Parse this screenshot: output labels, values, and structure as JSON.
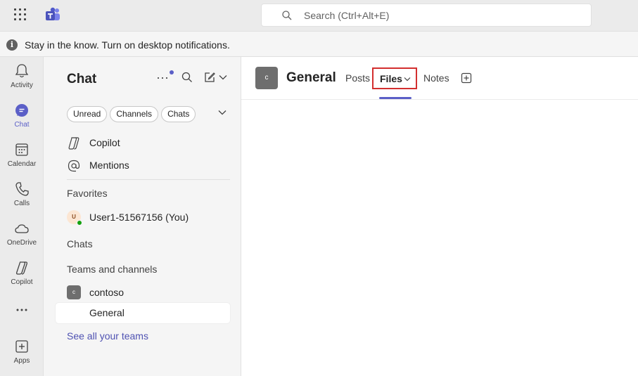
{
  "titlebar": {
    "app_icon": "teams-logo-icon",
    "search_placeholder": "Search (Ctrl+Alt+E)"
  },
  "notification": {
    "text": "Stay in the know. Turn on desktop notifications."
  },
  "rail": {
    "items": [
      {
        "label": "Activity",
        "icon": "bell-icon"
      },
      {
        "label": "Chat",
        "icon": "chat-icon",
        "active": true
      },
      {
        "label": "Calendar",
        "icon": "calendar-icon"
      },
      {
        "label": "Calls",
        "icon": "phone-icon"
      },
      {
        "label": "OneDrive",
        "icon": "cloud-icon"
      },
      {
        "label": "Copilot",
        "icon": "copilot-icon"
      },
      {
        "label": "Apps",
        "icon": "add-apps-icon"
      }
    ]
  },
  "chat_pane": {
    "title": "Chat",
    "filters": [
      "Unread",
      "Channels",
      "Chats"
    ],
    "pinned": [
      {
        "label": "Copilot",
        "icon": "copilot-icon"
      },
      {
        "label": "Mentions",
        "icon": "at-icon"
      }
    ],
    "favorites_label": "Favorites",
    "favorite_user": {
      "label": "User1-51567156 (You)",
      "initial": "U"
    },
    "chats_label": "Chats",
    "teams_label": "Teams and channels",
    "team": {
      "name": "contoso",
      "initial": "c"
    },
    "channel": {
      "name": "General"
    },
    "see_all": "See all your teams"
  },
  "main": {
    "channel_initial": "c",
    "channel_name": "General",
    "tabs": {
      "posts": "Posts",
      "files": "Files",
      "notes": "Notes"
    }
  },
  "colors": {
    "accent": "#5b5fc7",
    "highlight_box": "#d32f2f",
    "presence_available": "#13a10e"
  }
}
